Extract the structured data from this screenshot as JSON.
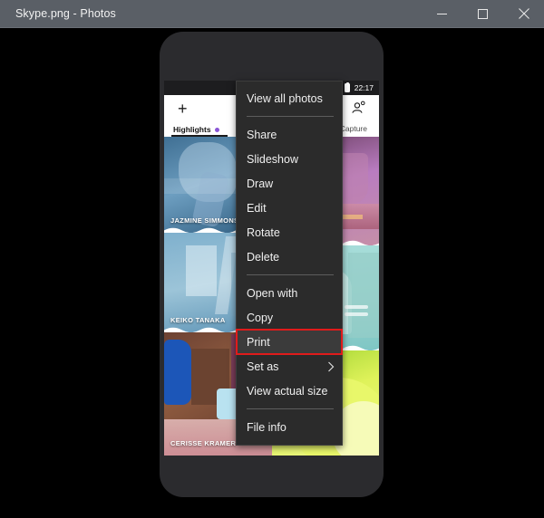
{
  "window": {
    "title": "Skype.png - Photos",
    "controls": [
      {
        "name": "minimize-button",
        "label": "Minimize",
        "glyph": "minimize-icon"
      },
      {
        "name": "maximize-button",
        "label": "Maximize",
        "glyph": "maximize-icon"
      },
      {
        "name": "close-button",
        "label": "Close",
        "glyph": "close-icon"
      }
    ]
  },
  "photo": {
    "status_bar": {
      "time": "22:17",
      "battery": "battery-icon"
    },
    "skype": {
      "add_icon": "plus-icon",
      "person_add_icon": "person-add-icon",
      "tabs": [
        {
          "label": "Highlights",
          "selected": true,
          "badge_dot": true
        },
        {
          "label": "Capture",
          "selected": false
        }
      ],
      "highlights": [
        {
          "name": "JAZMINE SIMMONS",
          "color": "#4a7fa8"
        },
        {
          "name": "KEIKO TANAKA",
          "color": "#6fa2c2"
        },
        {
          "name": "CERISSE KRAMER",
          "color": "#8d4f3a"
        },
        {
          "name": "",
          "color": "#b07fc0"
        },
        {
          "name": "",
          "color": "#8fd0cc"
        },
        {
          "name": "",
          "color": "#d9ef4f"
        }
      ]
    }
  },
  "context_menu": {
    "highlight_color": "#e01b1b",
    "items": [
      {
        "label": "View all photos",
        "type": "item",
        "name": "menu-item-view-all-photos"
      },
      {
        "type": "separator",
        "name": "menu-separator-1"
      },
      {
        "label": "Share",
        "type": "item",
        "name": "menu-item-share"
      },
      {
        "label": "Slideshow",
        "type": "item",
        "name": "menu-item-slideshow"
      },
      {
        "label": "Draw",
        "type": "item",
        "name": "menu-item-draw"
      },
      {
        "label": "Edit",
        "type": "item",
        "name": "menu-item-edit"
      },
      {
        "label": "Rotate",
        "type": "item",
        "name": "menu-item-rotate"
      },
      {
        "label": "Delete",
        "type": "item",
        "name": "menu-item-delete"
      },
      {
        "type": "separator",
        "name": "menu-separator-2"
      },
      {
        "label": "Open with",
        "type": "item",
        "name": "menu-item-open-with"
      },
      {
        "label": "Copy",
        "type": "item",
        "name": "menu-item-copy"
      },
      {
        "label": "Print",
        "type": "item",
        "name": "menu-item-print",
        "highlighted": true
      },
      {
        "label": "Set as",
        "type": "item",
        "name": "menu-item-set-as",
        "submenu": true
      },
      {
        "label": "View actual size",
        "type": "item",
        "name": "menu-item-view-actual-size"
      },
      {
        "type": "separator",
        "name": "menu-separator-3"
      },
      {
        "label": "File info",
        "type": "item",
        "name": "menu-item-file-info"
      }
    ]
  }
}
